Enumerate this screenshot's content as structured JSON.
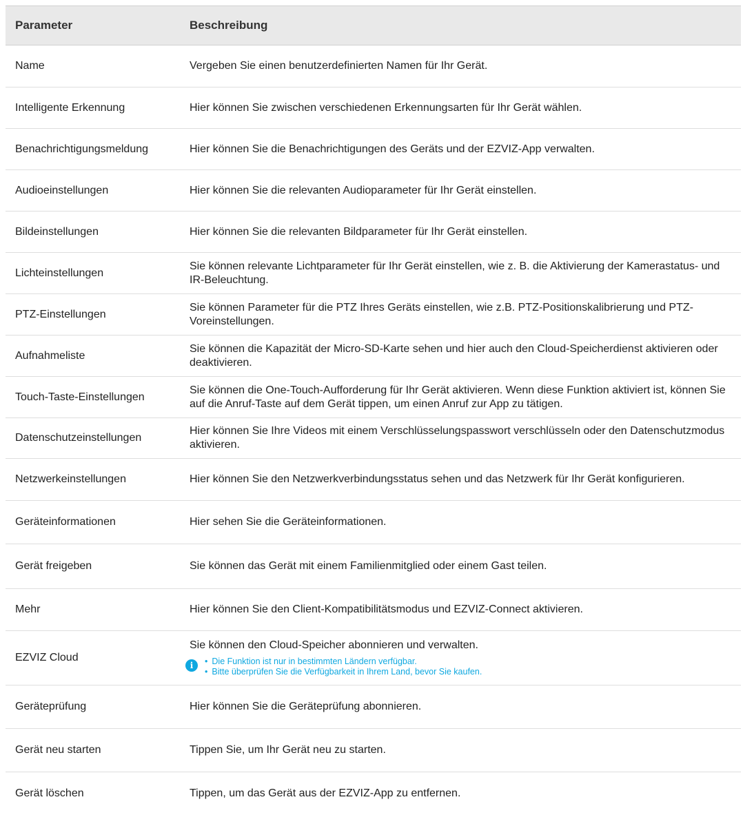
{
  "header": {
    "col1": "Parameter",
    "col2": "Beschreibung"
  },
  "rows": [
    {
      "param": "Name",
      "desc": "Vergeben Sie einen benutzerdefinierten Namen für Ihr Gerät."
    },
    {
      "param": "Intelligente Erkennung",
      "desc": "Hier können Sie zwischen verschiedenen Erkennungsarten für Ihr Gerät wählen."
    },
    {
      "param": "Benachrichtigungsmeldung",
      "desc": "Hier können Sie die Benachrichtigungen des Geräts und der EZVIZ-App verwalten."
    },
    {
      "param": "Audioeinstellungen",
      "desc": "Hier können Sie die relevanten Audioparameter für Ihr Gerät einstellen."
    },
    {
      "param": "Bildeinstellungen",
      "desc": "Hier können Sie die relevanten Bildparameter für Ihr Gerät einstellen."
    },
    {
      "param": "Lichteinstellungen",
      "desc": "Sie können relevante Lichtparameter für Ihr Gerät einstellen, wie z. B. die Aktivierung der Kamerastatus- und IR-Beleuchtung."
    },
    {
      "param": "PTZ-Einstellungen",
      "desc": "Sie können Parameter für die PTZ Ihres Geräts einstellen, wie z.B. PTZ-Positionskalibrierung und PTZ-Voreinstellungen."
    },
    {
      "param": "Aufnahmeliste",
      "desc": "Sie können die Kapazität der Micro-SD-Karte  sehen und hier auch den Cloud-Speicherdienst aktivieren oder deaktivieren."
    },
    {
      "param": "Touch-Taste-Einstellungen",
      "desc": "Sie können die One-Touch-Aufforderung für Ihr Gerät aktivieren. Wenn diese Funktion aktiviert ist, können Sie auf die Anruf-Taste auf dem Gerät tippen, um einen Anruf zur App zu tätigen."
    },
    {
      "param": "Datenschutzeinstellungen",
      "desc": "Hier können Sie Ihre Videos mit einem Verschlüsselungspasswort verschlüsseln oder den Datenschutzmodus aktivieren."
    },
    {
      "param": "Netzwerkeinstellungen",
      "desc": "Hier können Sie den Netzwerkverbindungsstatus sehen und das Netzwerk für Ihr Gerät konfigurieren."
    },
    {
      "param": "Geräteinformationen",
      "desc": "Hier sehen Sie die Geräteinformationen."
    },
    {
      "param": "Gerät freigeben",
      "desc": "Sie können das Gerät mit einem Familienmitglied oder einem Gast teilen."
    },
    {
      "param": "Mehr",
      "desc": "Hier können Sie den Client-Kompatibilitätsmodus und EZVIZ-Connect aktivieren."
    },
    {
      "param": "EZVIZ Cloud",
      "desc": "Sie können den Cloud-Speicher abonnieren und verwalten.",
      "notes": [
        "Die Funktion ist nur in bestimmten Ländern verfügbar.",
        "Bitte überprüfen Sie die Verfügbarkeit in Ihrem Land, bevor Sie kaufen."
      ]
    },
    {
      "param": "Geräteprüfung",
      "desc": "Hier können Sie die Geräteprüfung abonnieren."
    },
    {
      "param": "Gerät neu starten",
      "desc": "Tippen Sie, um Ihr Gerät neu zu starten."
    },
    {
      "param": "Gerät löschen",
      "desc": "Tippen, um das Gerät aus der EZVIZ-App zu entfernen."
    }
  ],
  "note_icon": "info-icon",
  "colors": {
    "header_bg": "#e9e9e9",
    "note_text": "#0fa8e0",
    "icon": "#0fa8e0"
  }
}
